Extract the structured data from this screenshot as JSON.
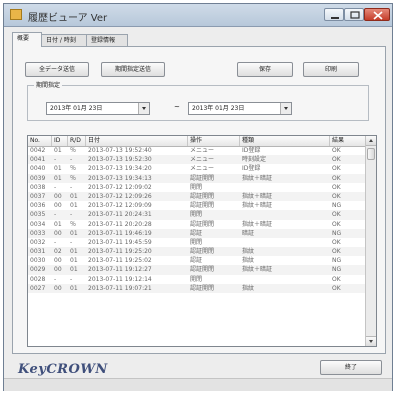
{
  "window": {
    "title": "履歴ビューア Ver"
  },
  "tabs": [
    "概要",
    "日付 / 時刻",
    "登録情報"
  ],
  "toolbar": {
    "all_data_send": "全データ送信",
    "period_send": "期間指定送信",
    "save": "保存",
    "print": "印刷"
  },
  "period": {
    "label": "期間指定",
    "start": "2013年 01月 23日",
    "separator": "~",
    "end": "2013年 01月 23日"
  },
  "table": {
    "columns": [
      "No.",
      "ID",
      "R/D",
      "日付",
      "操作",
      "種類",
      "結果"
    ],
    "rows": [
      [
        "0042",
        "01",
        "％",
        "2013-07-13 19:52:40",
        "メニュー",
        "ID登録",
        "OK"
      ],
      [
        "0041",
        "-",
        "-",
        "2013-07-13 19:52:30",
        "メニュー",
        "時刻設定",
        "OK"
      ],
      [
        "0040",
        "01",
        "％",
        "2013-07-13 19:34:20",
        "メニュー",
        "ID登録",
        "OK"
      ],
      [
        "0039",
        "01",
        "％",
        "2013-07-13 19:34:13",
        "認証開閉",
        "指紋＋暗証",
        "OK"
      ],
      [
        "0038",
        "-",
        "-",
        "2013-07-12 12:09:02",
        "開閉",
        "",
        "OK"
      ],
      [
        "0037",
        "00",
        "01",
        "2013-07-12 12:09:26",
        "認証開閉",
        "指紋＋暗証",
        "OK"
      ],
      [
        "0036",
        "00",
        "01",
        "2013-07-12 12:09:09",
        "認証開閉",
        "指紋＋暗証",
        "NG"
      ],
      [
        "0035",
        "-",
        "-",
        "2013-07-11 20:24:31",
        "開閉",
        "",
        "OK"
      ],
      [
        "0034",
        "01",
        "％",
        "2013-07-11 20:20:28",
        "認証開閉",
        "指紋＋暗証",
        "OK"
      ],
      [
        "0033",
        "00",
        "01",
        "2013-07-11 19:46:19",
        "認証",
        "暗証",
        "NG"
      ],
      [
        "0032",
        "-",
        "-",
        "2013-07-11 19:45:59",
        "開閉",
        "",
        "OK"
      ],
      [
        "0031",
        "02",
        "01",
        "2013-07-11 19:25:20",
        "認証開閉",
        "指紋",
        "OK"
      ],
      [
        "0030",
        "00",
        "01",
        "2013-07-11 19:25:02",
        "認証",
        "指紋",
        "NG"
      ],
      [
        "0029",
        "00",
        "01",
        "2013-07-11 19:12:27",
        "認証開閉",
        "指紋＋暗証",
        "NG"
      ],
      [
        "0028",
        "-",
        "-",
        "2013-07-11 19:12:14",
        "開閉",
        "",
        "OK"
      ],
      [
        "0027",
        "00",
        "01",
        "2013-07-11 19:07:21",
        "認証開閉",
        "指紋",
        "OK"
      ]
    ]
  },
  "footer": {
    "logo": "KeyCROWN",
    "close": "終了"
  }
}
